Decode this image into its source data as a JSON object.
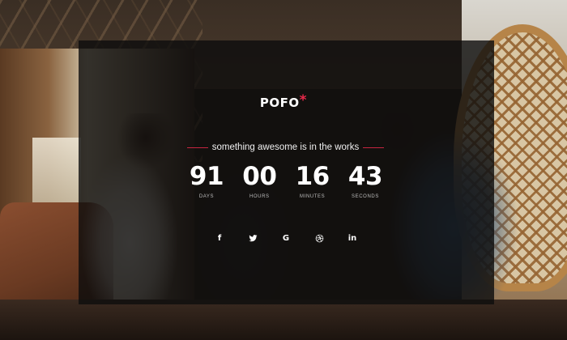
{
  "brand": {
    "name": "POFO",
    "mark": "*",
    "accent_color": "#e8294a"
  },
  "tagline": "something awesome is in the works",
  "countdown": {
    "days": {
      "value": "91",
      "label": "DAYS"
    },
    "hours": {
      "value": "00",
      "label": "HOURS"
    },
    "minutes": {
      "value": "16",
      "label": "MINUTES"
    },
    "seconds": {
      "value": "43",
      "label": "SECONDS"
    }
  },
  "social": [
    {
      "icon": "facebook-icon",
      "glyph": "f"
    },
    {
      "icon": "twitter-icon",
      "glyph": ""
    },
    {
      "icon": "google-icon",
      "glyph": "G"
    },
    {
      "icon": "dribbble-icon",
      "glyph": ""
    },
    {
      "icon": "linkedin-icon",
      "glyph": "in"
    }
  ]
}
